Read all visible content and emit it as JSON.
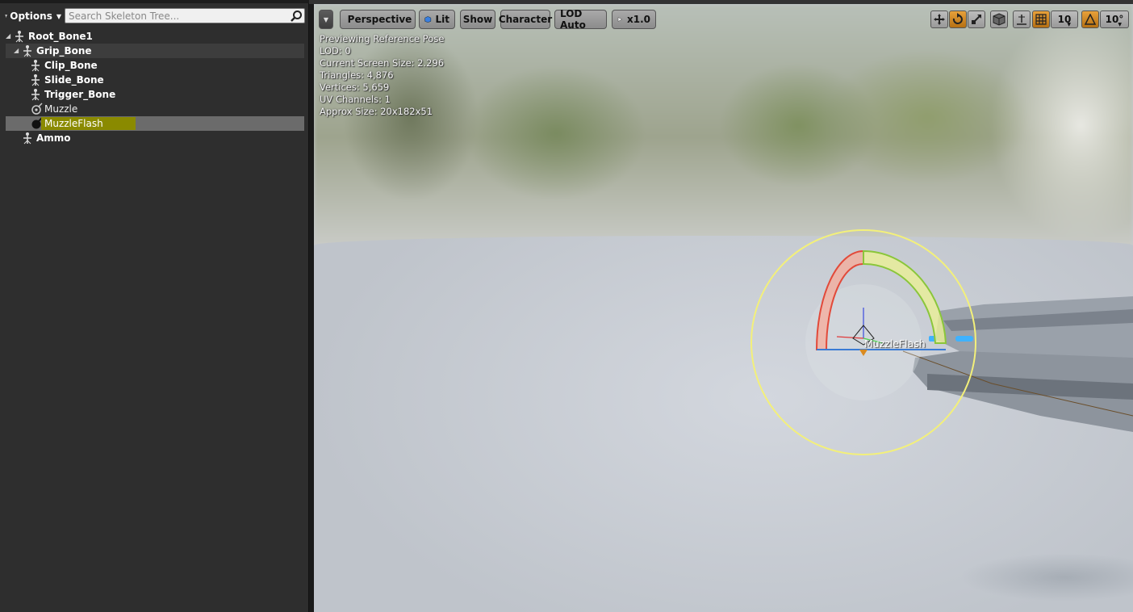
{
  "skeleton_tree": {
    "options_label": "Options",
    "search_placeholder": "Search Skeleton Tree...",
    "items": [
      {
        "label": "Root_Bone1",
        "type": "bone"
      },
      {
        "label": "Grip_Bone",
        "type": "bone"
      },
      {
        "label": "Clip_Bone",
        "type": "bone"
      },
      {
        "label": "Slide_Bone",
        "type": "bone"
      },
      {
        "label": "Trigger_Bone",
        "type": "bone"
      },
      {
        "label": "Muzzle",
        "type": "socket"
      },
      {
        "label": "MuzzleFlash",
        "type": "socket",
        "selected": true
      },
      {
        "label": "Ammo",
        "type": "bone"
      }
    ]
  },
  "viewport": {
    "toolbar": {
      "perspective": "Perspective",
      "lit": "Lit",
      "show": "Show",
      "character": "Character",
      "lod": "LOD Auto",
      "play_rate": "x1.0",
      "grid_snap_value": "10",
      "rotation_snap_value": "10°"
    },
    "stats": [
      "Previewing Reference Pose",
      "LOD: 0",
      "Current Screen Size: 2.296",
      "Triangles: 4,876",
      "Vertices: 5,659",
      "UV Channels: 1",
      "Approx Size: 20x182x51"
    ],
    "socket_label": "MuzzleFlash"
  },
  "colors": {
    "selection_highlight": "#8a8a00",
    "active_toggle": "#d98a20"
  }
}
